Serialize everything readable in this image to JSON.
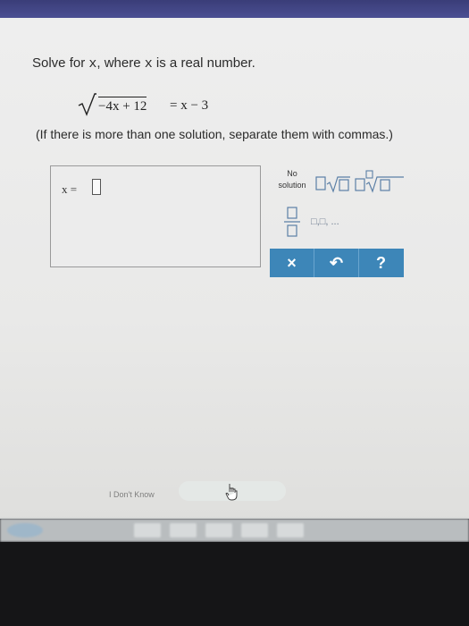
{
  "prompt": {
    "text_prefix": "Solve for ",
    "var1": "x",
    "text_mid": ", where ",
    "var2": "x",
    "text_suffix": " is a real number."
  },
  "equation": {
    "radicand": "−4x + 12",
    "rhs": "= x − 3"
  },
  "instruction": "(If there is more than one solution, separate them with commas.)",
  "answer": {
    "lhs": "x  ="
  },
  "palette": {
    "no_solution_line1": "No",
    "no_solution_line2": "solution",
    "list_label": "□,□, ..."
  },
  "keybar": {
    "clear": "×",
    "undo": "↶",
    "help": "?"
  },
  "footer": {
    "dont_know": "I Don't Know"
  },
  "colors": {
    "keybar": "#3d86b8",
    "header": "#4b4f93"
  }
}
